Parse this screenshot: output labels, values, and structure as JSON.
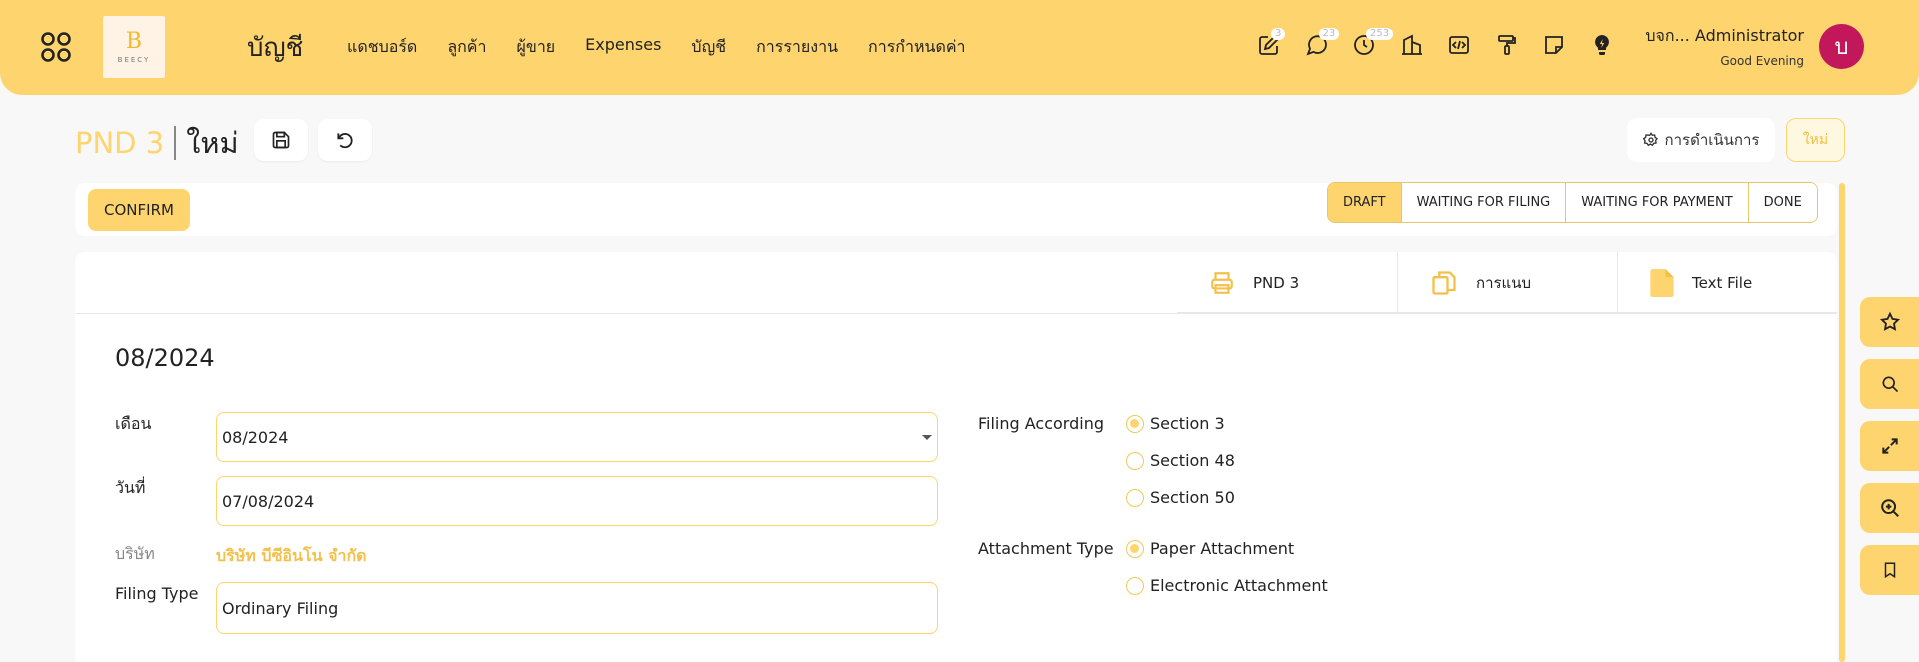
{
  "topbar": {
    "logo_letter": "B",
    "logo_text": "BEECY",
    "app_title": "บัญชี",
    "menu": [
      {
        "label": "แดชบอร์ด"
      },
      {
        "label": "ลูกค้า"
      },
      {
        "label": "ผู้ขาย"
      },
      {
        "label": "Expenses"
      },
      {
        "label": "บัญชี"
      },
      {
        "label": "การรายงาน"
      },
      {
        "label": "การกำหนดค่า"
      }
    ],
    "icons": [
      {
        "name": "edit-icon",
        "badge": "3"
      },
      {
        "name": "chat-icon",
        "badge": "23"
      },
      {
        "name": "clock-icon",
        "badge": "253"
      },
      {
        "name": "building-icon",
        "badge": ""
      },
      {
        "name": "code-icon",
        "badge": ""
      },
      {
        "name": "paint-roller-icon",
        "badge": ""
      },
      {
        "name": "sticky-note-icon",
        "badge": ""
      },
      {
        "name": "lightbulb-icon",
        "badge": ""
      }
    ],
    "user_name": "บจก... Administrator",
    "greeting": "Good Evening",
    "avatar_letter": "บ"
  },
  "title_row": {
    "doc_name": "PND 3",
    "record_state": "ใหม่",
    "actions_label": "การดำเนินการ",
    "new_label": "ใหม่"
  },
  "status_bar": {
    "confirm_label": "CONFIRM",
    "stages": [
      {
        "label": "DRAFT",
        "active": true
      },
      {
        "label": "WAITING FOR FILING",
        "active": false
      },
      {
        "label": "WAITING FOR PAYMENT",
        "active": false
      },
      {
        "label": "DONE",
        "active": false
      }
    ]
  },
  "smart_buttons": [
    {
      "label": "PND 3",
      "icon": "printer-icon"
    },
    {
      "label": "การแนบ",
      "icon": "attachment-icon"
    },
    {
      "label": "Text File",
      "icon": "file-icon"
    }
  ],
  "form": {
    "record_title": "08/2024",
    "month_label": "เดือน",
    "month_value": "08/2024",
    "date_label": "วันที่",
    "date_value": "07/08/2024",
    "company_label": "บริษัท",
    "company_value": "บริษัท บีซีอินโน จำกัด",
    "filing_type_label": "Filing Type",
    "filing_type_value": "Ordinary Filing",
    "filing_according_label": "Filing According",
    "filing_according_options": [
      {
        "label": "Section 3",
        "checked": true
      },
      {
        "label": "Section 48",
        "checked": false
      },
      {
        "label": "Section 50",
        "checked": false
      }
    ],
    "attachment_type_label": "Attachment Type",
    "attachment_type_options": [
      {
        "label": "Paper Attachment",
        "checked": true
      },
      {
        "label": "Electronic Attachment",
        "checked": false
      }
    ]
  },
  "dock": [
    "star-icon",
    "search-icon",
    "expand-icon",
    "zoom-in-icon",
    "bookmark-icon"
  ],
  "colors": {
    "accent": "#fed46f",
    "avatar": "#c2185b",
    "company_text": "#f3c14b"
  }
}
